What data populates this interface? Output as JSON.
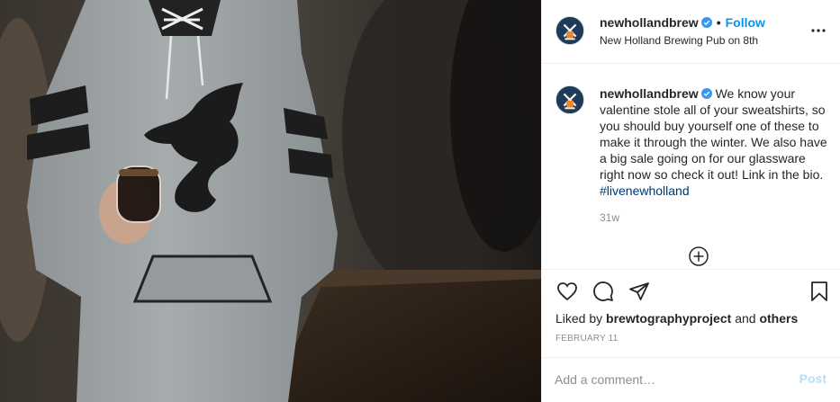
{
  "post": {
    "image_alt": "",
    "header": {
      "username": "newhollandbrew",
      "separator": "•",
      "follow_label": "Follow",
      "location": "New Holland Brewing Pub on 8th"
    },
    "caption": {
      "username": "newhollandbrew",
      "text": "We know your valentine stole all of your sweatshirts, so you should buy yourself one of these to make it through the winter. We also have a big sale going on for our glassware right now so check it out! Link in the bio.",
      "hashtag": "#livenewholland",
      "age": "31w"
    },
    "likes": {
      "prefix": "Liked by",
      "first_liker": "brewtographyproject",
      "conjunction": "and",
      "others": "others"
    },
    "date": "FEBRUARY 11",
    "comment": {
      "placeholder": "Add a comment…",
      "post_label": "Post"
    },
    "icons": [
      "verified-icon",
      "more-options-icon",
      "load-more-comments-icon",
      "heart-icon",
      "comment-icon",
      "share-icon",
      "save-bookmark-icon"
    ],
    "colors": {
      "link_blue": "#0095f6",
      "hashtag_blue": "#00376b",
      "post_disabled": "#b2dffc",
      "muted_text": "#8e8e8e",
      "border": "#efefef"
    }
  }
}
